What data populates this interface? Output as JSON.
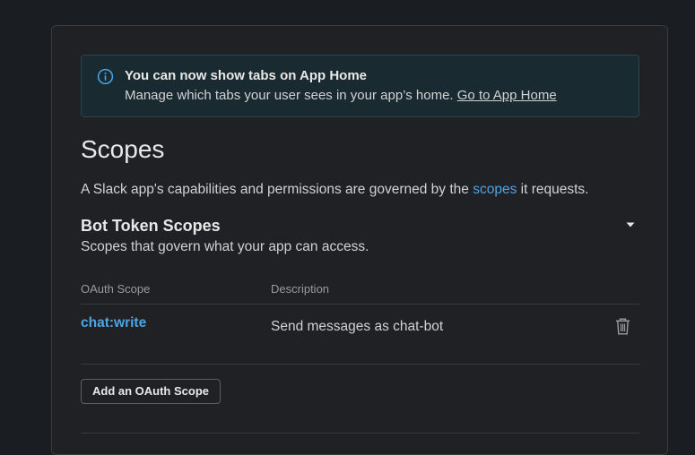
{
  "banner": {
    "title": "You can now show tabs on App Home",
    "text": "Manage which tabs your user sees in your app’s home.",
    "link": "Go to App Home"
  },
  "section": {
    "title": "Scopes",
    "description_prefix": "A Slack app's capabilities and permissions are governed by the",
    "description_link": "scopes",
    "description_suffix": "it requests."
  },
  "bot_scopes": {
    "title": "Bot Token Scopes",
    "description": "Scopes that govern what your app can access.",
    "columns": [
      "OAuth Scope",
      "Description"
    ],
    "rows": [
      {
        "scope": "chat:write",
        "description": "Send messages as chat-bot"
      }
    ],
    "add_button": "Add an OAuth Scope"
  },
  "icons": {
    "banner": "info-icon",
    "collapse": "caret-down-icon",
    "remove": "trash-icon"
  },
  "colors": {
    "background": "#1a1d21",
    "link": "#4aa6e6",
    "banner_bg": "#1a2a31"
  }
}
